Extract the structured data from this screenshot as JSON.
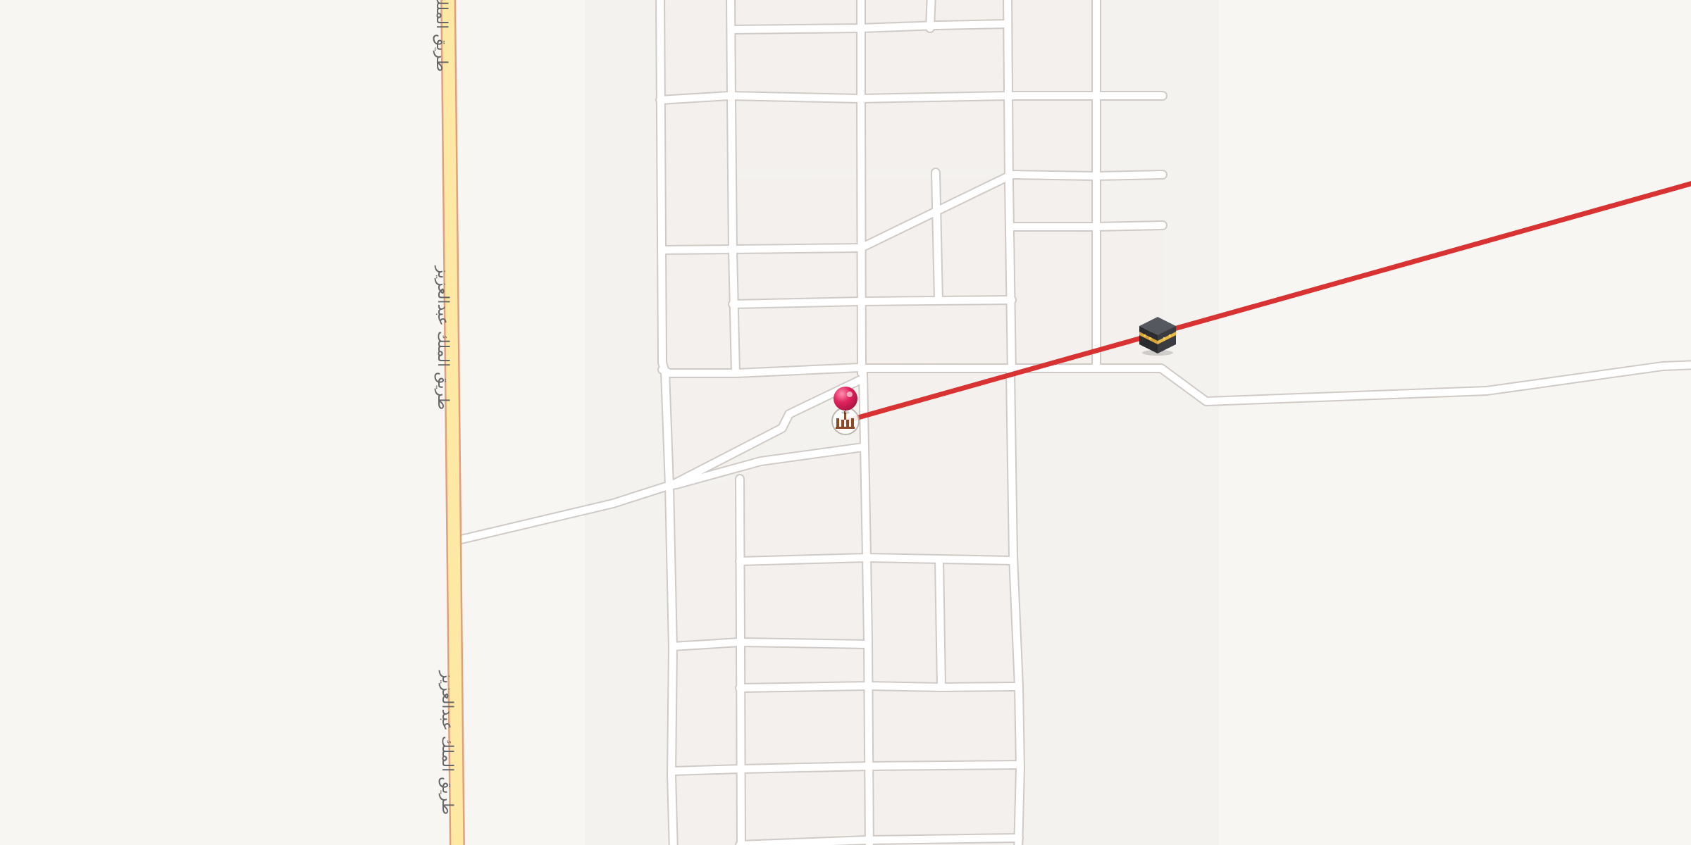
{
  "map": {
    "colors": {
      "background": "#f8f6f2",
      "block": "#f3f0ed",
      "road_fill": "#ffffff",
      "road_edge": "#cfcac6",
      "main_road_fill": "#fde8a4",
      "main_road_edge": "#e0a080",
      "qibla_line": "#d93232",
      "pin": "#e0245e"
    },
    "road_labels": [
      "طريق الملك عبدالعزيز",
      "طريق الملك عبدالعزيز",
      "طريق الملك عبدالعزيز"
    ],
    "markers": {
      "user_location": {
        "icon": "location-pin-icon"
      },
      "mosque": {
        "icon": "mosque-icon"
      },
      "kaaba": {
        "icon": "kaaba-icon"
      }
    },
    "qibla_line": {
      "label": ""
    }
  }
}
